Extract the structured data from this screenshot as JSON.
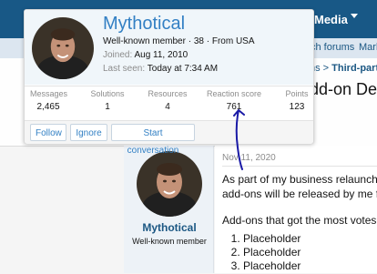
{
  "nav": {
    "media_label": "Media",
    "subnav_item_1": "ch forums",
    "subnav_item_2": "Mark"
  },
  "breadcrumb": {
    "separator": "ns >",
    "current": "Third-party"
  },
  "thread": {
    "title_fragment": "dd-on De"
  },
  "member_card": {
    "name": "Mythotical",
    "user_title": "Well-known member · 38 · From USA",
    "joined_label": "Joined:",
    "joined_value": "Aug 11, 2010",
    "last_seen_label": "Last seen:",
    "last_seen_value": "Today at 7:34 AM",
    "stats": [
      {
        "label": "Messages",
        "value": "2,465"
      },
      {
        "label": "Solutions",
        "value": "1"
      },
      {
        "label": "Resources",
        "value": "4"
      },
      {
        "label": "Reaction score",
        "value": "761"
      },
      {
        "label": "Points",
        "value": "123"
      }
    ],
    "actions": {
      "follow": "Follow",
      "ignore": "Ignore",
      "start_conversation": "Start conversation"
    }
  },
  "post": {
    "author_name": "Mythotical",
    "author_title": "Well-known member",
    "date": "Nov 11, 2020",
    "line1": "As part of my business relaunch an",
    "line2": "add-ons will be released by me for",
    "line3": "Add-ons that got the most votes:",
    "list_items": [
      "Placeholder",
      "Placeholder",
      "Placeholder"
    ]
  },
  "colors": {
    "nav_bg": "#185886",
    "link": "#3380c4",
    "card_header_bg": "#f0f6fa",
    "annotation_ink": "#1a1aa6"
  }
}
